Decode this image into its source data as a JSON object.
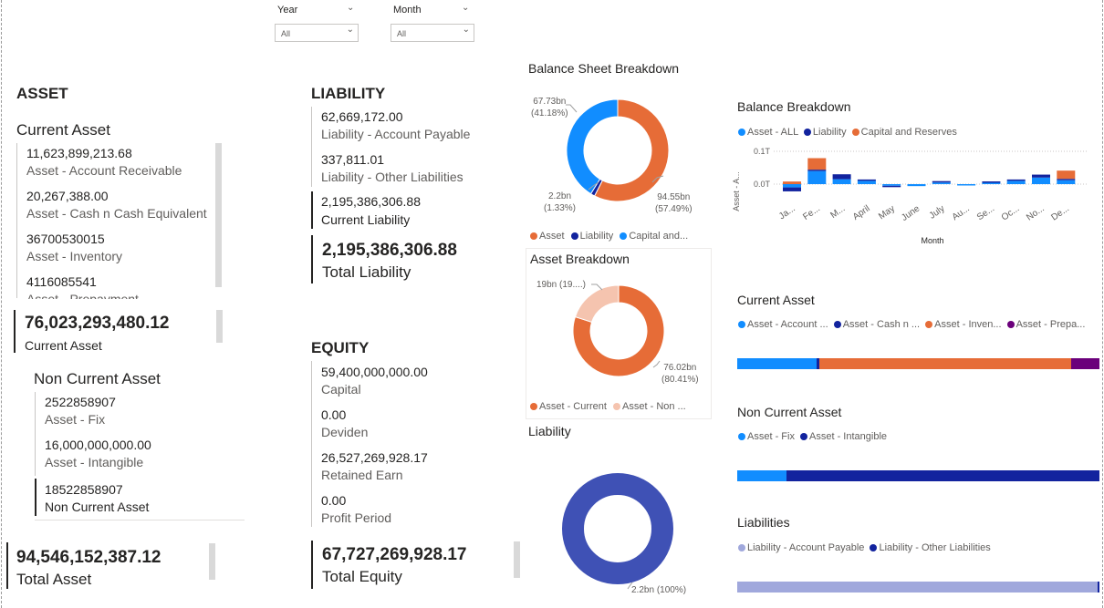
{
  "colors": {
    "orange": "#e66c37",
    "navy": "#12239e",
    "blue": "#118dff",
    "purple": "#6b007b",
    "peach": "#f5c4af",
    "donut_blue": "#3f51b5",
    "lavender": "#a0a8dc"
  },
  "slicers": {
    "year": {
      "label": "Year",
      "value": "All"
    },
    "month": {
      "label": "Month",
      "value": "All"
    }
  },
  "asset": {
    "title": "ASSET",
    "current": {
      "title": "Current Asset",
      "items": [
        {
          "value": "11,623,899,213.68",
          "label": "Asset - Account Receivable"
        },
        {
          "value": "20,267,388.00",
          "label": "Asset - Cash n Cash Equivalent"
        },
        {
          "value": "36700530015",
          "label": "Asset - Inventory"
        },
        {
          "value": "4116085541",
          "label": "Asset - Prepayment"
        }
      ],
      "total_value": "76,023,293,480.12",
      "total_label": "Current Asset"
    },
    "noncurrent": {
      "title": "Non Current Asset",
      "items": [
        {
          "value": "2522858907",
          "label": "Asset - Fix"
        },
        {
          "value": "16,000,000,000.00",
          "label": "Asset - Intangible"
        }
      ],
      "total_value": "18522858907",
      "total_label": "Non Current Asset"
    },
    "total_value": "94,546,152,387.12",
    "total_label": "Total Asset"
  },
  "liability": {
    "title": "LIABILITY",
    "items": [
      {
        "value": "62,669,172.00",
        "label": "Liability - Account Payable"
      },
      {
        "value": "337,811.01",
        "label": "Liability - Other Liabilities"
      }
    ],
    "current_value": "2,195,386,306.88",
    "current_label": "Current Liability",
    "total_value": "2,195,386,306.88",
    "total_label": "Total Liability"
  },
  "equity": {
    "title": "EQUITY",
    "items": [
      {
        "value": "59,400,000,000.00",
        "label": "Capital"
      },
      {
        "value": "0.00",
        "label": "Deviden"
      },
      {
        "value": "26,527,269,928.17",
        "label": "Retained Earn"
      },
      {
        "value": "0.00",
        "label": "Profit Period"
      }
    ],
    "total_value": "67,727,269,928.17",
    "total_label": "Total Equity"
  },
  "chart_data": [
    {
      "id": "balance-sheet-breakdown",
      "type": "pie",
      "title": "Balance Sheet Breakdown",
      "categories": [
        "Asset",
        "Liability",
        "Capital and..."
      ],
      "values": [
        94.55,
        2.2,
        67.73
      ],
      "value_labels": [
        "94.55bn",
        "2.2bn",
        "67.73bn"
      ],
      "percent_labels": [
        "(57.49%)",
        "(1.33%)",
        "(41.18%)"
      ]
    },
    {
      "id": "asset-breakdown",
      "type": "pie",
      "title": "Asset Breakdown",
      "categories": [
        "Asset - Current",
        "Asset - Non ..."
      ],
      "values": [
        76.02,
        19
      ],
      "value_labels": [
        "76.02bn",
        "19bn"
      ],
      "percent_labels": [
        "(80.41%)",
        "(19....)"
      ]
    },
    {
      "id": "liability",
      "type": "pie",
      "title": "Liability",
      "categories": [
        "Liability"
      ],
      "values": [
        2.2
      ],
      "value_labels": [
        "2.2bn"
      ],
      "percent_labels": [
        "(100%)"
      ]
    },
    {
      "id": "balance-breakdown",
      "type": "bar",
      "title": "Balance Breakdown",
      "xlabel": "Month",
      "ylabel": "Asset - A...",
      "categories": [
        "Ja...",
        "Fe...",
        "M...",
        "April",
        "May",
        "June",
        "July",
        "Au...",
        "Se...",
        "Oc...",
        "No...",
        "De..."
      ],
      "yticks": [
        "0.1T",
        "0.0T"
      ],
      "ylim": [
        -0.03,
        0.1
      ],
      "series": [
        {
          "name": "Asset - ALL",
          "values": [
            -0.01,
            0.04,
            0.015,
            0.01,
            -0.005,
            -0.006,
            0.005,
            -0.004,
            0.003,
            0.01,
            0.02,
            0.012
          ]
        },
        {
          "name": "Liability",
          "values": [
            -0.012,
            0.001,
            0.015,
            0.001,
            -0.002,
            0.0,
            0.003,
            0.0,
            0.001,
            0.004,
            0.009,
            0.001
          ]
        },
        {
          "name": "Capital and Reserves",
          "values": [
            0.008,
            0.035,
            0.0,
            0.0,
            0.0,
            0.0,
            0.0,
            0.0,
            0.0,
            0.0,
            0.0,
            0.025
          ]
        }
      ]
    },
    {
      "id": "current-asset-stack",
      "type": "bar",
      "title": "Current Asset",
      "categories": [
        ""
      ],
      "series": [
        {
          "name": "Asset - Account ...",
          "values": [
            11.62
          ]
        },
        {
          "name": "Asset - Cash n ...",
          "values": [
            0.02
          ]
        },
        {
          "name": "Asset - Inven...",
          "values": [
            36.7
          ]
        },
        {
          "name": "Asset - Prepa...",
          "values": [
            4.12
          ]
        }
      ]
    },
    {
      "id": "noncurrent-asset-stack",
      "type": "bar",
      "title": "Non Current Asset",
      "categories": [
        ""
      ],
      "series": [
        {
          "name": "Asset - Fix",
          "values": [
            2.52
          ]
        },
        {
          "name": "Asset - Intangible",
          "values": [
            16.0
          ]
        }
      ]
    },
    {
      "id": "liabilities-stack",
      "type": "bar",
      "title": "Liabilities",
      "categories": [
        ""
      ],
      "series": [
        {
          "name": "Liability - Account Payable",
          "values": [
            62.67
          ]
        },
        {
          "name": "Liability - Other Liabilities",
          "values": [
            0.34
          ]
        }
      ]
    }
  ]
}
